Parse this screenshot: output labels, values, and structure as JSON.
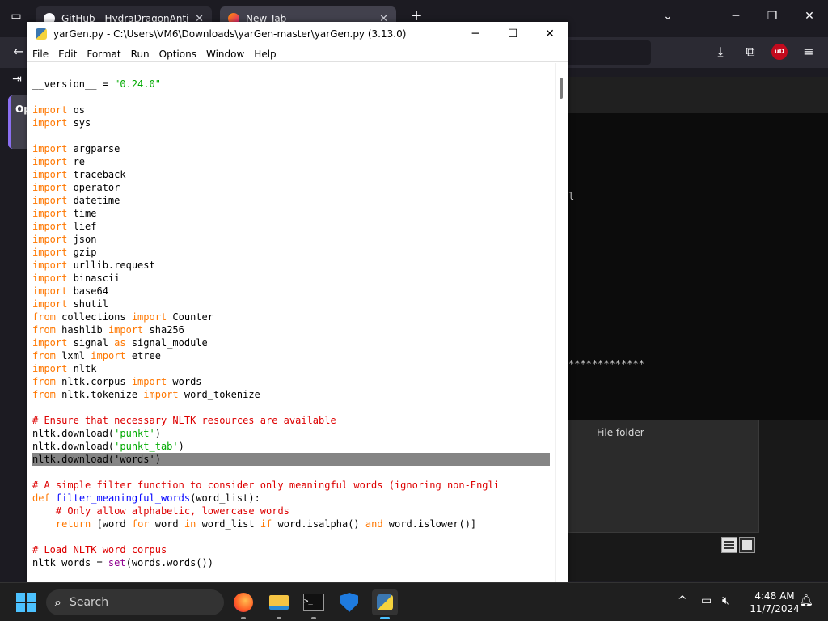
{
  "browser": {
    "tabs": [
      {
        "label": "GitHub - HydraDragonAntiviru"
      },
      {
        "label": "New Tab"
      }
    ],
    "new_tab": "+",
    "tab_list": "⌄",
    "minimize": "─",
    "maximize": "❐",
    "close": "✕",
    "ublock_badge": "uD",
    "sidebar_label": "Op"
  },
  "idle": {
    "title": "yarGen.py - C:\\Users\\VM6\\Downloads\\yarGen-master\\yarGen.py (3.13.0)",
    "controls": {
      "minimize": "─",
      "maximize": "☐",
      "close": "✕"
    },
    "menu": [
      "File",
      "Edit",
      "Format",
      "Run",
      "Options",
      "Window",
      "Help"
    ],
    "code": [
      {
        "segs": [
          {
            "t": "__version__ = "
          },
          {
            "t": "\"0.24.0\"",
            "c": "str"
          }
        ]
      },
      {
        "segs": []
      },
      {
        "segs": [
          {
            "t": "import",
            "c": "kw"
          },
          {
            "t": " os"
          }
        ]
      },
      {
        "segs": [
          {
            "t": "import",
            "c": "kw"
          },
          {
            "t": " sys"
          }
        ]
      },
      {
        "segs": []
      },
      {
        "segs": [
          {
            "t": "import",
            "c": "kw"
          },
          {
            "t": " argparse"
          }
        ]
      },
      {
        "segs": [
          {
            "t": "import",
            "c": "kw"
          },
          {
            "t": " re"
          }
        ]
      },
      {
        "segs": [
          {
            "t": "import",
            "c": "kw"
          },
          {
            "t": " traceback"
          }
        ]
      },
      {
        "segs": [
          {
            "t": "import",
            "c": "kw"
          },
          {
            "t": " operator"
          }
        ]
      },
      {
        "segs": [
          {
            "t": "import",
            "c": "kw"
          },
          {
            "t": " datetime"
          }
        ]
      },
      {
        "segs": [
          {
            "t": "import",
            "c": "kw"
          },
          {
            "t": " time"
          }
        ]
      },
      {
        "segs": [
          {
            "t": "import",
            "c": "kw"
          },
          {
            "t": " lief"
          }
        ]
      },
      {
        "segs": [
          {
            "t": "import",
            "c": "kw"
          },
          {
            "t": " json"
          }
        ]
      },
      {
        "segs": [
          {
            "t": "import",
            "c": "kw"
          },
          {
            "t": " gzip"
          }
        ]
      },
      {
        "segs": [
          {
            "t": "import",
            "c": "kw"
          },
          {
            "t": " urllib.request"
          }
        ]
      },
      {
        "segs": [
          {
            "t": "import",
            "c": "kw"
          },
          {
            "t": " binascii"
          }
        ]
      },
      {
        "segs": [
          {
            "t": "import",
            "c": "kw"
          },
          {
            "t": " base64"
          }
        ]
      },
      {
        "segs": [
          {
            "t": "import",
            "c": "kw"
          },
          {
            "t": " shutil"
          }
        ]
      },
      {
        "segs": [
          {
            "t": "from",
            "c": "kw"
          },
          {
            "t": " collections "
          },
          {
            "t": "import",
            "c": "kw"
          },
          {
            "t": " Counter"
          }
        ]
      },
      {
        "segs": [
          {
            "t": "from",
            "c": "kw"
          },
          {
            "t": " hashlib "
          },
          {
            "t": "import",
            "c": "kw"
          },
          {
            "t": " sha256"
          }
        ]
      },
      {
        "segs": [
          {
            "t": "import",
            "c": "kw"
          },
          {
            "t": " signal "
          },
          {
            "t": "as",
            "c": "kw"
          },
          {
            "t": " signal_module"
          }
        ]
      },
      {
        "segs": [
          {
            "t": "from",
            "c": "kw"
          },
          {
            "t": " lxml "
          },
          {
            "t": "import",
            "c": "kw"
          },
          {
            "t": " etree"
          }
        ]
      },
      {
        "segs": [
          {
            "t": "import",
            "c": "kw"
          },
          {
            "t": " nltk"
          }
        ]
      },
      {
        "segs": [
          {
            "t": "from",
            "c": "kw"
          },
          {
            "t": " nltk.corpus "
          },
          {
            "t": "import",
            "c": "kw"
          },
          {
            "t": " words"
          }
        ]
      },
      {
        "segs": [
          {
            "t": "from",
            "c": "kw"
          },
          {
            "t": " nltk.tokenize "
          },
          {
            "t": "import",
            "c": "kw"
          },
          {
            "t": " word_tokenize"
          }
        ]
      },
      {
        "segs": []
      },
      {
        "segs": [
          {
            "t": "# Ensure that necessary NLTK resources are available",
            "c": "com"
          }
        ]
      },
      {
        "segs": [
          {
            "t": "nltk.download("
          },
          {
            "t": "'punkt'",
            "c": "str"
          },
          {
            "t": ")"
          }
        ]
      },
      {
        "segs": [
          {
            "t": "nltk.download("
          },
          {
            "t": "'punkt_tab'",
            "c": "str"
          },
          {
            "t": ")"
          }
        ]
      },
      {
        "segs": [
          {
            "t": "nltk.download("
          },
          {
            "t": "'words'"
          },
          {
            "t": ")"
          }
        ],
        "highlight": true
      },
      {
        "segs": []
      },
      {
        "segs": [
          {
            "t": "# A simple filter function to consider only meaningful words (ignoring non-Engli",
            "c": "com"
          }
        ]
      },
      {
        "segs": [
          {
            "t": "def",
            "c": "kw"
          },
          {
            "t": " "
          },
          {
            "t": "filter_meaningful_words",
            "c": "def"
          },
          {
            "t": "(word_list):"
          }
        ]
      },
      {
        "segs": [
          {
            "t": "    "
          },
          {
            "t": "# Only allow alphabetic, lowercase words",
            "c": "com"
          }
        ]
      },
      {
        "segs": [
          {
            "t": "    "
          },
          {
            "t": "return",
            "c": "kw"
          },
          {
            "t": " [word "
          },
          {
            "t": "for",
            "c": "kw"
          },
          {
            "t": " word "
          },
          {
            "t": "in",
            "c": "kw"
          },
          {
            "t": " word_list "
          },
          {
            "t": "if",
            "c": "kw"
          },
          {
            "t": " word.isalpha() "
          },
          {
            "t": "and",
            "c": "kw"
          },
          {
            "t": " word.islower()]"
          }
        ]
      },
      {
        "segs": []
      },
      {
        "segs": [
          {
            "t": "# Load NLTK word corpus",
            "c": "com"
          }
        ]
      },
      {
        "segs": [
          {
            "t": "nltk_words = "
          },
          {
            "t": "set",
            "c": "bi"
          },
          {
            "t": "(words.words())"
          }
        ]
      }
    ]
  },
  "background": {
    "terminal_stars": "*************",
    "terminal_fragment": "l",
    "explorer_item_type": "File folder"
  },
  "taskbar": {
    "search_placeholder": "Search",
    "time": "4:48 AM",
    "date": "11/7/2024",
    "tray_chevron": "^"
  }
}
